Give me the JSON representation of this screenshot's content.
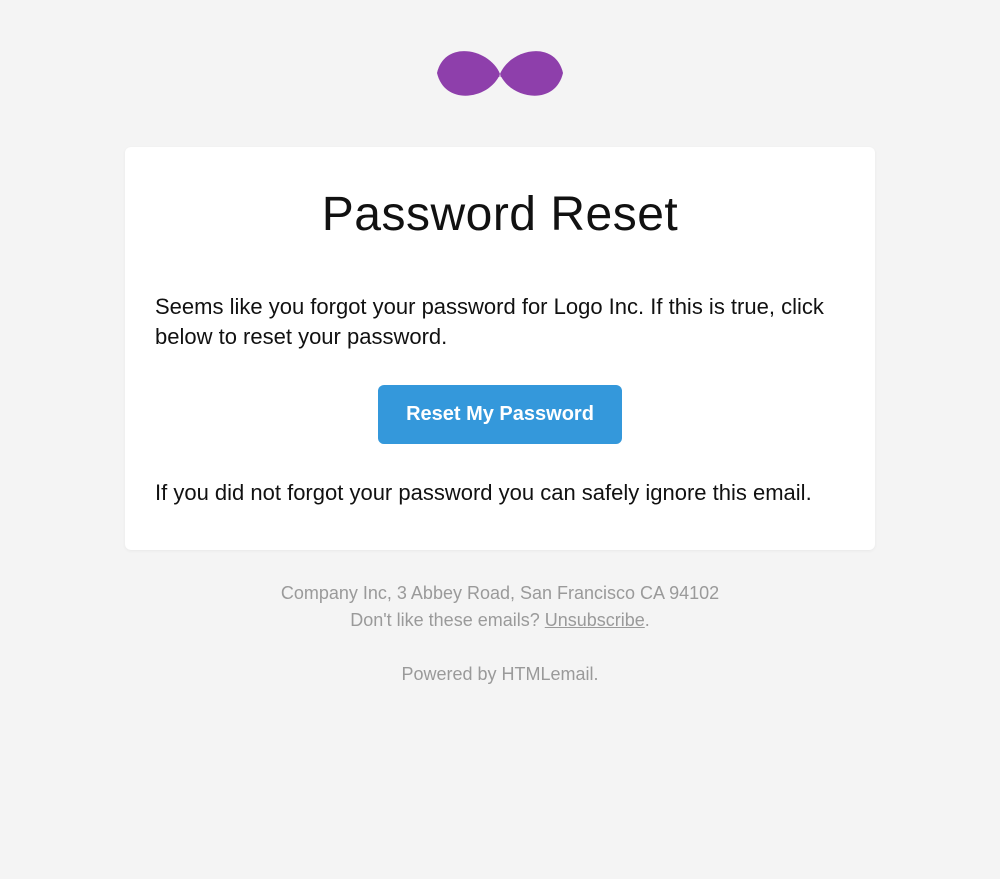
{
  "colors": {
    "accent": "#3498db",
    "logo": "#8e3fab",
    "background": "#f4f4f4",
    "card": "#ffffff",
    "text": "#111111",
    "muted": "#9a9a9a"
  },
  "header": {
    "logo_icon": "bowtie-icon"
  },
  "main": {
    "title": "Password Reset",
    "intro_text": "Seems like you forgot your password for Logo Inc. If this is true, click below to reset your password.",
    "button_label": "Reset My Password",
    "ignore_text": "If you did not forgot your password you can safely ignore this email."
  },
  "footer": {
    "address": "Company Inc, 3 Abbey Road, San Francisco CA 94102",
    "unsubscribe_prefix": "Don't like these emails? ",
    "unsubscribe_link": "Unsubscribe",
    "unsubscribe_suffix": ".",
    "powered_by": "Powered by HTMLemail."
  }
}
